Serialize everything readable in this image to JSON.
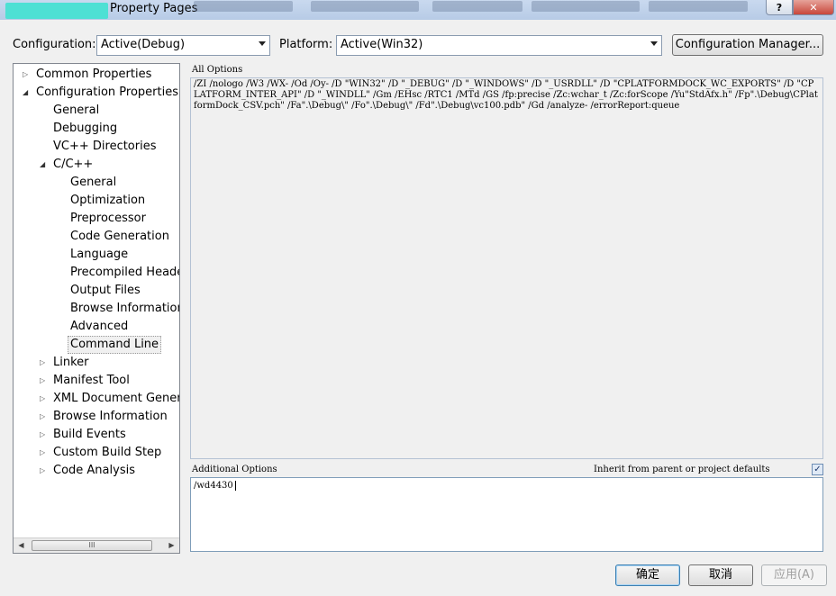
{
  "window": {
    "title": "Property Pages",
    "help_glyph": "?",
    "close_glyph": "✕"
  },
  "toolbar": {
    "configuration_label": "Configuration:",
    "configuration_value": "Active(Debug)",
    "platform_label": "Platform:",
    "platform_value": "Active(Win32)",
    "config_manager_label": "Configuration Manager..."
  },
  "tree": {
    "items": [
      {
        "label": "Common Properties",
        "expander": "▷"
      },
      {
        "label": "Configuration Properties",
        "expander": "◢"
      },
      {
        "label": "General"
      },
      {
        "label": "Debugging"
      },
      {
        "label": "VC++ Directories"
      },
      {
        "label": "C/C++",
        "expander": "◢"
      },
      {
        "label": "General"
      },
      {
        "label": "Optimization"
      },
      {
        "label": "Preprocessor"
      },
      {
        "label": "Code Generation"
      },
      {
        "label": "Language"
      },
      {
        "label": "Precompiled Header"
      },
      {
        "label": "Output Files"
      },
      {
        "label": "Browse Information"
      },
      {
        "label": "Advanced"
      },
      {
        "label": "Command Line",
        "selected": true
      },
      {
        "label": "Linker",
        "expander": "▷"
      },
      {
        "label": "Manifest Tool",
        "expander": "▷"
      },
      {
        "label": "XML Document Generat",
        "expander": "▷"
      },
      {
        "label": "Browse Information",
        "expander": "▷"
      },
      {
        "label": "Build Events",
        "expander": "▷"
      },
      {
        "label": "Custom Build Step",
        "expander": "▷"
      },
      {
        "label": "Code Analysis",
        "expander": "▷"
      }
    ],
    "scroll_left": "◀",
    "scroll_right": "▶",
    "scroll_thumb": "III"
  },
  "panel": {
    "all_options_label": "All Options",
    "all_options_text": "/ZI /nologo /W3 /WX- /Od /Oy- /D \"WIN32\" /D \"_DEBUG\" /D \"_WINDOWS\" /D \"_USRDLL\" /D \"CPLATFORMDOCK_WC_EXPORTS\" /D \"CPLATFORM_INTER_API\" /D \"_WINDLL\" /Gm /EHsc /RTC1 /MTd /GS /fp:precise /Zc:wchar_t /Zc:forScope /Yu\"StdAfx.h\" /Fp\".\\Debug\\CPlatformDock_CSV.pch\" /Fa\".\\Debug\\\" /Fo\".\\Debug\\\" /Fd\".\\Debug\\vc100.pdb\" /Gd /analyze- /errorReport:queue",
    "additional_options_label": "Additional Options",
    "inherit_label": "Inherit from parent or project defaults",
    "inherit_checked": true,
    "additional_options_value": "/wd4430"
  },
  "buttons": {
    "ok": "确定",
    "cancel": "取消",
    "apply": "应用(A)"
  }
}
